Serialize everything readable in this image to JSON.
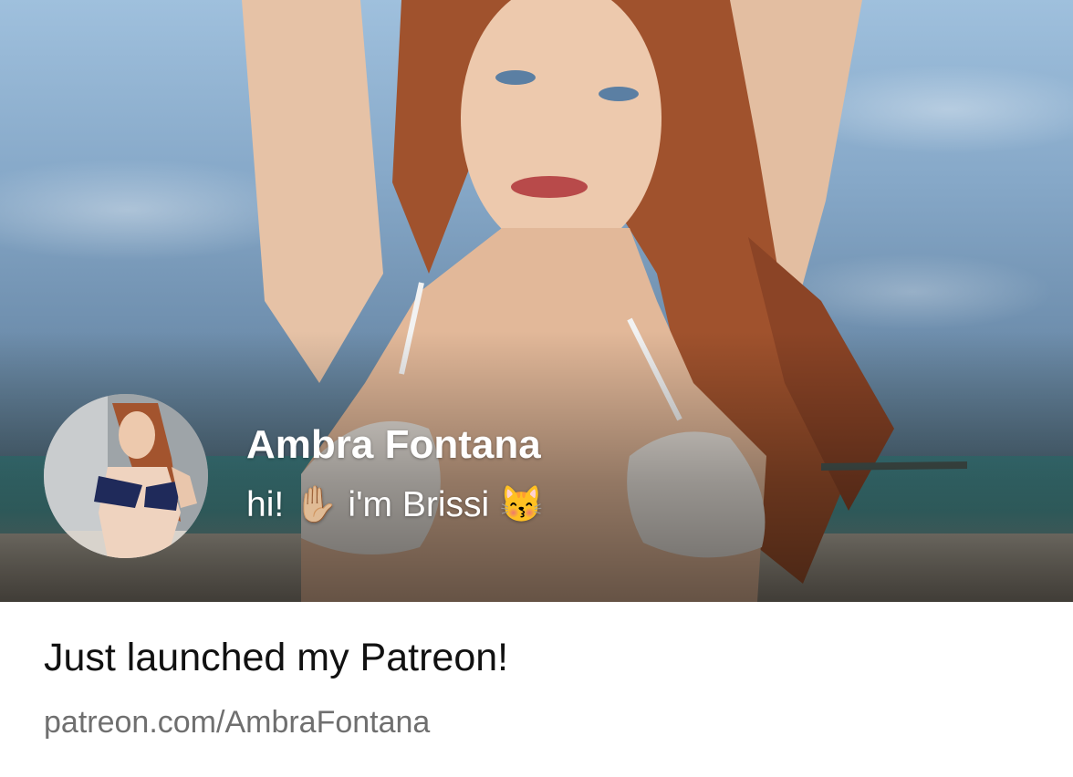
{
  "preview": {
    "hero_image": "cover-photo",
    "profile": {
      "avatar": "profile-photo",
      "name": "Ambra Fontana",
      "bio": "hi! ✋🏼 i'm Brissi 😽"
    },
    "title": "Just launched my Patreon!",
    "url_text": "patreon.com/AmbraFontana"
  },
  "colors": {
    "text_primary": "#111111",
    "text_secondary": "#6f6f6f",
    "overlay_text": "#ffffff",
    "background": "#ffffff"
  }
}
